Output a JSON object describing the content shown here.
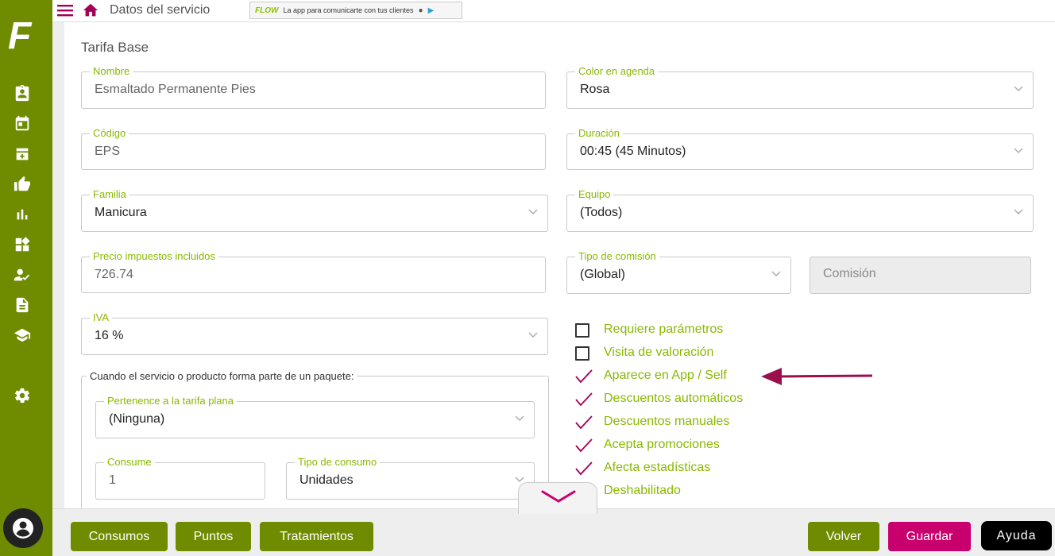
{
  "sidebar": {
    "logo": "F",
    "icons": [
      "clipboard-user-icon",
      "calendar-icon",
      "box-plus-icon",
      "thumbs-up-icon",
      "bar-chart-icon",
      "widgets-icon",
      "user-check-icon",
      "document-icon",
      "graduation-cap-icon",
      "gear-icon"
    ]
  },
  "topbar": {
    "title": "Datos del servicio",
    "banner_brand": "FLOW",
    "banner_text": "La app para comunicarte con tus clientes"
  },
  "form": {
    "section_title": "Tarifa Base",
    "nombre": {
      "label": "Nombre",
      "value": "Esmaltado Permanente Pies"
    },
    "codigo": {
      "label": "Código",
      "value": "EPS"
    },
    "familia": {
      "label": "Familia",
      "value": "Manicura"
    },
    "precio": {
      "label": "Precio impuestos incluidos",
      "value": "726.74"
    },
    "iva": {
      "label": "IVA",
      "value": "16 %"
    },
    "color_agenda": {
      "label": "Color en agenda",
      "value": "Rosa"
    },
    "duracion": {
      "label": "Duración",
      "value": "00:45 (45 Minutos)"
    },
    "equipo": {
      "label": "Equipo",
      "value": "(Todos)"
    },
    "tipo_comision": {
      "label": "Tipo de comisión",
      "value": "(Global)"
    },
    "comision": {
      "placeholder": "Comisión"
    },
    "package": {
      "legend": "Cuando el servicio o producto forma parte de un paquete:",
      "tarifa_plana": {
        "label": "Pertenence a la tarifa plana",
        "value": "(Ninguna)"
      },
      "consume": {
        "label": "Consume",
        "value": "1"
      },
      "tipo_consumo": {
        "label": "Tipo de consumo",
        "value": "Unidades"
      }
    },
    "options": [
      {
        "label": "Requiere parámetros",
        "checked": false
      },
      {
        "label": "Visita de valoración",
        "checked": false
      },
      {
        "label": "Aparece en App / Self",
        "checked": true
      },
      {
        "label": "Descuentos automáticos",
        "checked": true
      },
      {
        "label": "Descuentos manuales",
        "checked": true
      },
      {
        "label": "Acepta promociones",
        "checked": true
      },
      {
        "label": "Afecta estadísticas",
        "checked": true
      },
      {
        "label": "Deshabilitado",
        "checked": false
      }
    ]
  },
  "bottombar": {
    "consumos": "Consumos",
    "puntos": "Puntos",
    "tratamientos": "Tratamientos",
    "volver": "Volver",
    "guardar": "Guardar",
    "ayuda": "Ayuda"
  },
  "colors": {
    "brand_green": "#6f8c00",
    "label_green": "#8ab800",
    "accent_magenta": "#c8006d",
    "arrow_maroon": "#9c0f4f"
  }
}
